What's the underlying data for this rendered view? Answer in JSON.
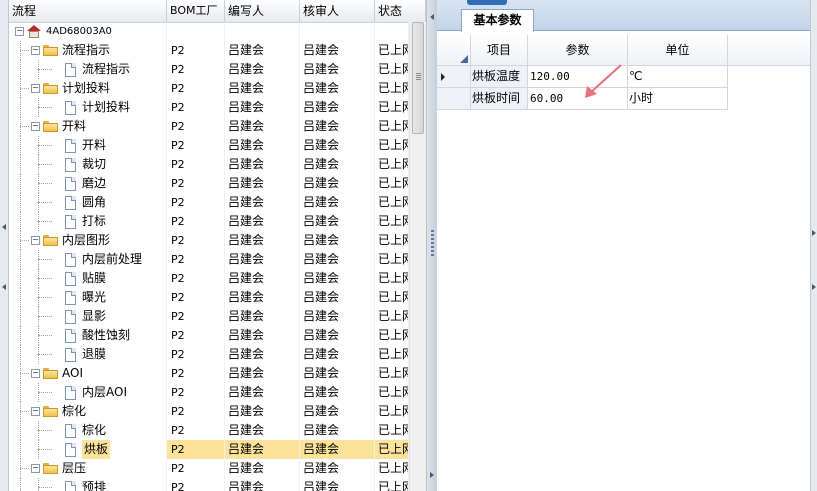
{
  "tree_headers": [
    "流程",
    "BOM工厂",
    "编写人",
    "核审人",
    "状态"
  ],
  "tree_rows": [
    {
      "level": 0,
      "type": "home",
      "toggle": "minus",
      "name": "4AD68003A0",
      "bom": "",
      "writer": "",
      "reviewer": "",
      "status": ""
    },
    {
      "level": 1,
      "type": "folder",
      "toggle": "minus",
      "name": "流程指示",
      "bom": "P2",
      "writer": "吕建会",
      "reviewer": "吕建会",
      "status": "已上网"
    },
    {
      "level": 2,
      "type": "doc",
      "toggle": "",
      "name": "流程指示",
      "bom": "P2",
      "writer": "吕建会",
      "reviewer": "吕建会",
      "status": "已上网"
    },
    {
      "level": 1,
      "type": "folder",
      "toggle": "minus",
      "name": "计划投料",
      "bom": "P2",
      "writer": "吕建会",
      "reviewer": "吕建会",
      "status": "已上网"
    },
    {
      "level": 2,
      "type": "doc",
      "toggle": "",
      "name": "计划投料",
      "bom": "P2",
      "writer": "吕建会",
      "reviewer": "吕建会",
      "status": "已上网"
    },
    {
      "level": 1,
      "type": "folder",
      "toggle": "minus",
      "name": "开料",
      "bom": "P2",
      "writer": "吕建会",
      "reviewer": "吕建会",
      "status": "已上网"
    },
    {
      "level": 2,
      "type": "doc",
      "toggle": "",
      "name": "开料",
      "bom": "P2",
      "writer": "吕建会",
      "reviewer": "吕建会",
      "status": "已上网"
    },
    {
      "level": 2,
      "type": "doc",
      "toggle": "",
      "name": "裁切",
      "bom": "P2",
      "writer": "吕建会",
      "reviewer": "吕建会",
      "status": "已上网"
    },
    {
      "level": 2,
      "type": "doc",
      "toggle": "",
      "name": "磨边",
      "bom": "P2",
      "writer": "吕建会",
      "reviewer": "吕建会",
      "status": "已上网"
    },
    {
      "level": 2,
      "type": "doc",
      "toggle": "",
      "name": "圆角",
      "bom": "P2",
      "writer": "吕建会",
      "reviewer": "吕建会",
      "status": "已上网"
    },
    {
      "level": 2,
      "type": "doc",
      "toggle": "",
      "name": "打标",
      "bom": "P2",
      "writer": "吕建会",
      "reviewer": "吕建会",
      "status": "已上网"
    },
    {
      "level": 1,
      "type": "folder",
      "toggle": "minus",
      "name": "内层图形",
      "bom": "P2",
      "writer": "吕建会",
      "reviewer": "吕建会",
      "status": "已上网"
    },
    {
      "level": 2,
      "type": "doc",
      "toggle": "",
      "name": "内层前处理",
      "bom": "P2",
      "writer": "吕建会",
      "reviewer": "吕建会",
      "status": "已上网"
    },
    {
      "level": 2,
      "type": "doc",
      "toggle": "",
      "name": "贴膜",
      "bom": "P2",
      "writer": "吕建会",
      "reviewer": "吕建会",
      "status": "已上网"
    },
    {
      "level": 2,
      "type": "doc",
      "toggle": "",
      "name": "曝光",
      "bom": "P2",
      "writer": "吕建会",
      "reviewer": "吕建会",
      "status": "已上网"
    },
    {
      "level": 2,
      "type": "doc",
      "toggle": "",
      "name": "显影",
      "bom": "P2",
      "writer": "吕建会",
      "reviewer": "吕建会",
      "status": "已上网"
    },
    {
      "level": 2,
      "type": "doc",
      "toggle": "",
      "name": "酸性蚀刻",
      "bom": "P2",
      "writer": "吕建会",
      "reviewer": "吕建会",
      "status": "已上网"
    },
    {
      "level": 2,
      "type": "doc",
      "toggle": "",
      "name": "退膜",
      "bom": "P2",
      "writer": "吕建会",
      "reviewer": "吕建会",
      "status": "已上网"
    },
    {
      "level": 1,
      "type": "folder",
      "toggle": "minus",
      "name": "AOI",
      "bom": "P2",
      "writer": "吕建会",
      "reviewer": "吕建会",
      "status": "已上网"
    },
    {
      "level": 2,
      "type": "doc",
      "toggle": "",
      "name": "内层AOI",
      "bom": "P2",
      "writer": "吕建会",
      "reviewer": "吕建会",
      "status": "已上网"
    },
    {
      "level": 1,
      "type": "folder",
      "toggle": "minus",
      "name": "棕化",
      "bom": "P2",
      "writer": "吕建会",
      "reviewer": "吕建会",
      "status": "已上网"
    },
    {
      "level": 2,
      "type": "doc",
      "toggle": "",
      "name": "棕化",
      "bom": "P2",
      "writer": "吕建会",
      "reviewer": "吕建会",
      "status": "已上网"
    },
    {
      "level": 2,
      "type": "doc",
      "toggle": "",
      "name": "烘板",
      "bom": "P2",
      "writer": "吕建会",
      "reviewer": "吕建会",
      "status": "已上网",
      "selected": true
    },
    {
      "level": 1,
      "type": "folder",
      "toggle": "minus",
      "name": "层压",
      "bom": "P2",
      "writer": "吕建会",
      "reviewer": "吕建会",
      "status": "已上网"
    },
    {
      "level": 2,
      "type": "doc",
      "toggle": "",
      "name": "预排",
      "bom": "P2",
      "writer": "吕建会",
      "reviewer": "吕建会",
      "status": "已上网"
    }
  ],
  "right_panel": {
    "tab_label": "基本参数",
    "headers": [
      "项目",
      "参数",
      "单位"
    ],
    "rows": [
      {
        "item": "烘板温度",
        "value": "120.00",
        "unit": "℃",
        "current": true
      },
      {
        "item": "烘板时间",
        "value": "60.00",
        "unit": "小时",
        "current": false
      }
    ]
  },
  "colors": {
    "selection": "#fbe39a",
    "header_bg": "#e7eaee",
    "tab_bar": "#c4d5ea",
    "annotation_arrow": "#e8707a"
  }
}
